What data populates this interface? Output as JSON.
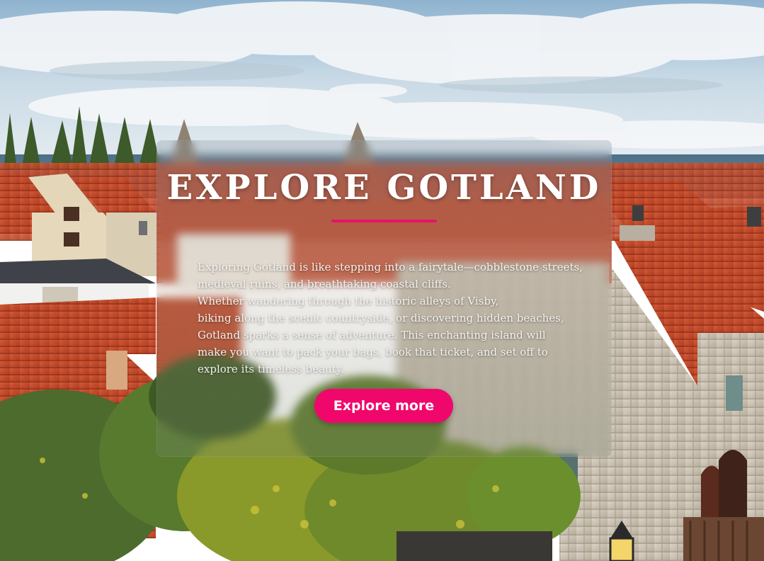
{
  "hero": {
    "title": "EXPLORE GOTLAND",
    "accent_color": "#e8126a",
    "paragraph_lines": [
      "Exploring Gotland is like stepping into a fairytale—cobblestone streets,",
      "medieval ruins, and breathtaking coastal cliffs.",
      "Whether wandering through the historic alleys of Visby,",
      "biking along the scenic countryside, or discovering hidden beaches,",
      "Gotland sparks a sense of adventure. This enchanting island will",
      "make you want to pack your bags, book that ticket, and set off to",
      "explore its timeless beauty."
    ],
    "cta_label": "Explore more",
    "cta_color": "#f0076c"
  },
  "background": {
    "scene": "medieval town rooftops of Visby with sea and cloudy sky"
  }
}
